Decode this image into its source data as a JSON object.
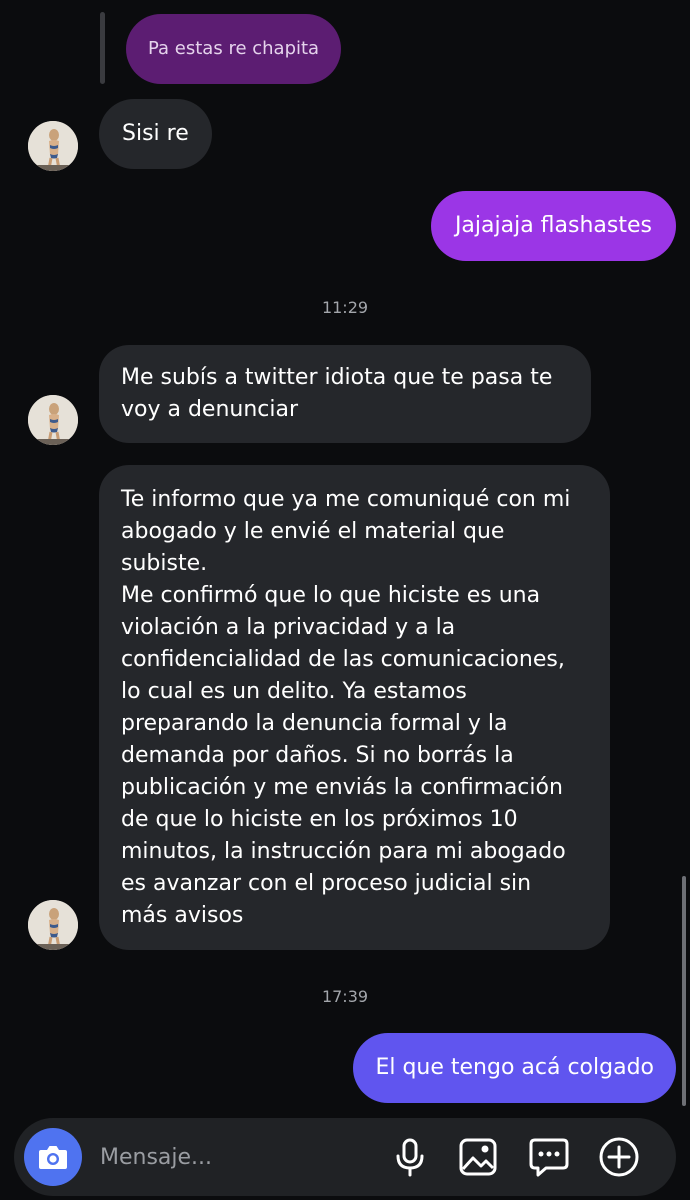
{
  "messages": {
    "reply_quote": "Pa estas re chapita",
    "m1": "Sisi re",
    "m2": "Jajajaja flashastes",
    "m3": "Me subís a twitter idiota que te pasa te\nvoy a denunciar",
    "m4": "Te informo que ya me comuniqué con mi\nabogado y le envié el material que\nsubiste.\nMe confirmó que lo que hiciste es una\nviolación a la privacidad y a la\nconfidencialidad de las comunicaciones,\nlo cual es un delito. Ya estamos\npreparando la denuncia formal y la\ndemanda por daños. Si no borrás la\npublicación y me enviás la confirmación\nde que lo hiciste en los próximos 10\nminutos, la instrucción para mi abogado\nes avanzar con el proceso judicial sin\nmás avisos",
    "m5": "El que tengo acá colgado"
  },
  "timestamps": {
    "t1": "11:29",
    "t2": "17:39"
  },
  "composer": {
    "placeholder": "Mensaje...",
    "value": ""
  },
  "icons": {
    "camera": "camera-icon",
    "mic": "mic-icon",
    "gallery": "gallery-icon",
    "sticker": "sticker-icon",
    "plus": "plus-icon"
  },
  "colors": {
    "background": "#0b0c0e",
    "incoming_bubble": "#25272b",
    "outgoing_bubble_purple": "#9b36e6",
    "outgoing_bubble_blue": "#6055ef",
    "reply_bubble": "#5c1d72",
    "camera_button": "#4f73f0"
  }
}
